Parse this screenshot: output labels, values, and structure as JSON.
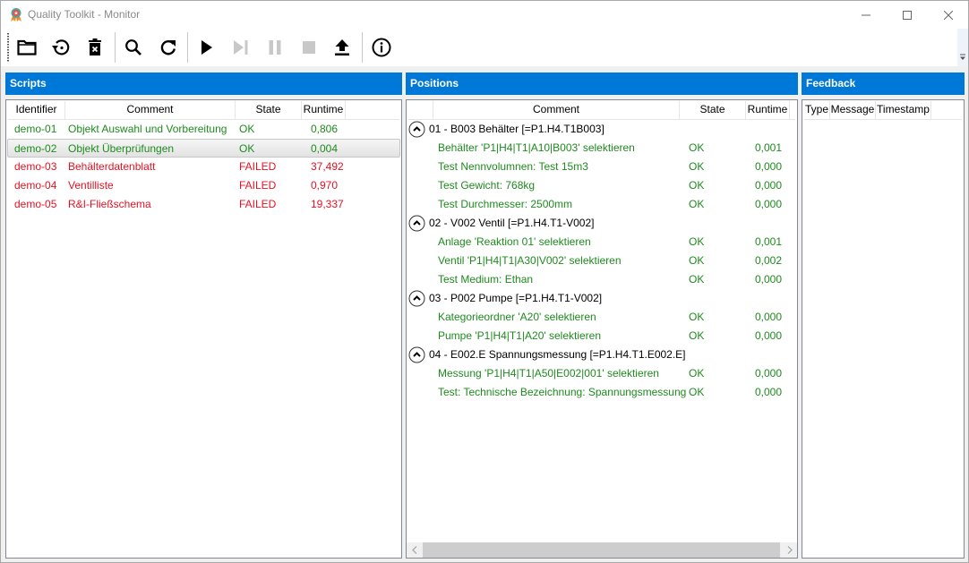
{
  "window": {
    "title": "Quality Toolkit - Monitor",
    "icon": "award-ribbon-icon",
    "controls": [
      "minimize",
      "maximize",
      "close"
    ]
  },
  "toolbar": {
    "buttons": [
      {
        "name": "open-folder",
        "icon": "folder-icon",
        "enabled": true
      },
      {
        "name": "restore",
        "icon": "history-icon",
        "enabled": true
      },
      {
        "name": "delete",
        "icon": "trash-icon",
        "enabled": true
      },
      {
        "name": "search",
        "icon": "search-icon",
        "enabled": true
      },
      {
        "name": "refresh",
        "icon": "refresh-icon",
        "enabled": true
      },
      {
        "name": "run",
        "icon": "play-icon",
        "enabled": true
      },
      {
        "name": "step",
        "icon": "step-forward-icon",
        "enabled": false
      },
      {
        "name": "pause",
        "icon": "pause-icon",
        "enabled": false
      },
      {
        "name": "stop",
        "icon": "stop-icon",
        "enabled": false
      },
      {
        "name": "upload",
        "icon": "upload-icon",
        "enabled": true
      },
      {
        "name": "info",
        "icon": "info-icon",
        "enabled": true
      }
    ]
  },
  "colors": {
    "header_blue": "#0078d7",
    "ok_green": "#1e8a1e",
    "failed_red": "#e81123"
  },
  "scripts": {
    "title": "Scripts",
    "columns": [
      "Identifier",
      "Comment",
      "State",
      "Runtime"
    ],
    "rows": [
      {
        "identifier": "demo-01",
        "comment": "Objekt Auswahl und Vorbereitung",
        "state": "OK",
        "runtime": "0,806",
        "status": "ok",
        "selected": false
      },
      {
        "identifier": "demo-02",
        "comment": "Objekt Überprüfungen",
        "state": "OK",
        "runtime": "0,004",
        "status": "ok",
        "selected": true
      },
      {
        "identifier": "demo-03",
        "comment": "Behälterdatenblatt",
        "state": "FAILED",
        "runtime": "37,492",
        "status": "failed",
        "selected": false
      },
      {
        "identifier": "demo-04",
        "comment": "Ventilliste",
        "state": "FAILED",
        "runtime": "0,970",
        "status": "failed",
        "selected": false
      },
      {
        "identifier": "demo-05",
        "comment": "R&I-Fließschema",
        "state": "FAILED",
        "runtime": "19,337",
        "status": "failed",
        "selected": false
      }
    ]
  },
  "positions": {
    "title": "Positions",
    "columns": [
      "",
      "Comment",
      "State",
      "Runtime"
    ],
    "groups": [
      {
        "label": "01 - B003 Behälter [=P1.H4.T1B003]",
        "expanded": true,
        "items": [
          {
            "comment": "Behälter 'P1|H4|T1|A10|B003' selektieren",
            "state": "OK",
            "runtime": "0,001"
          },
          {
            "comment": "Test Nennvolumnen: Test 15m3",
            "state": "OK",
            "runtime": "0,000"
          },
          {
            "comment": "Test Gewicht: 768kg",
            "state": "OK",
            "runtime": "0,000"
          },
          {
            "comment": "Test Durchmesser: 2500mm",
            "state": "OK",
            "runtime": "0,000"
          }
        ]
      },
      {
        "label": "02 - V002 Ventil [=P1.H4.T1-V002]",
        "expanded": true,
        "items": [
          {
            "comment": "Anlage 'Reaktion 01' selektieren",
            "state": "OK",
            "runtime": "0,001"
          },
          {
            "comment": "Ventil 'P1|H4|T1|A30|V002' selektieren",
            "state": "OK",
            "runtime": "0,002"
          },
          {
            "comment": "Test Medium: Ethan",
            "state": "OK",
            "runtime": "0,000"
          }
        ]
      },
      {
        "label": "03 - P002 Pumpe [=P1.H4.T1-V002]",
        "expanded": true,
        "items": [
          {
            "comment": "Kategorieordner 'A20' selektieren",
            "state": "OK",
            "runtime": "0,000"
          },
          {
            "comment": "Pumpe 'P1|H4|T1|A20' selektieren",
            "state": "OK",
            "runtime": "0,000"
          }
        ]
      },
      {
        "label": "04 - E002.E Spannungsmessung [=P1.H4.T1.E002.E]",
        "expanded": true,
        "items": [
          {
            "comment": "Messung 'P1|H4|T1|A50|E002|001' selektieren",
            "state": "OK",
            "runtime": "0,000"
          },
          {
            "comment": "Test: Technische Bezeichnung: Spannungsmessung",
            "state": "OK",
            "runtime": "0,000"
          }
        ]
      }
    ]
  },
  "feedback": {
    "title": "Feedback",
    "columns": [
      "Type",
      "Message",
      "Timestamp"
    ],
    "rows": []
  }
}
